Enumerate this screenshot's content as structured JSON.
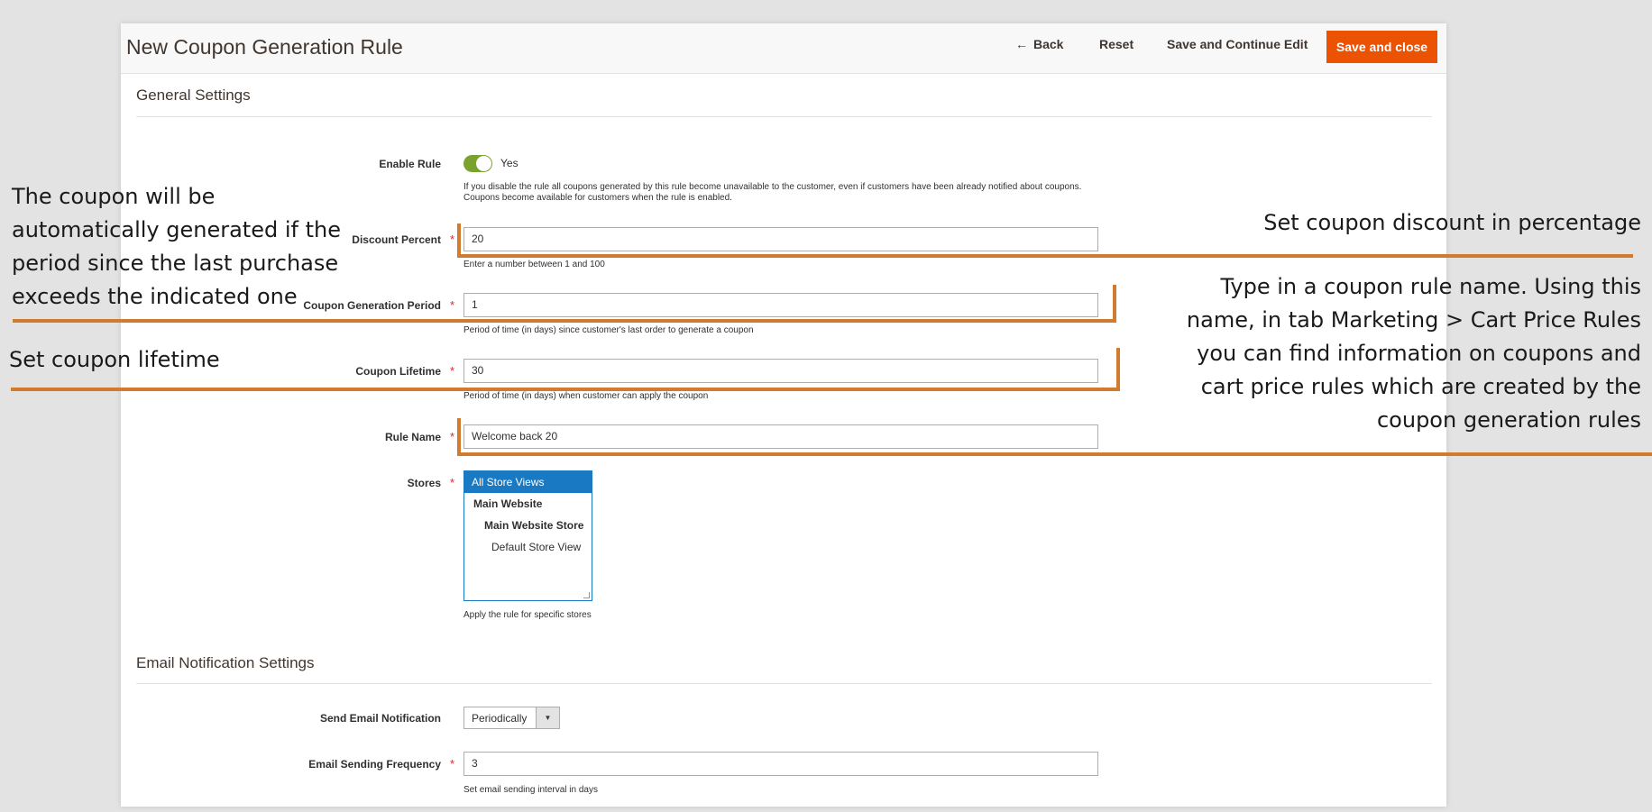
{
  "header": {
    "page_title": "New Coupon Generation Rule",
    "back_label": "Back",
    "reset_label": "Reset",
    "save_continue_label": "Save and Continue Edit",
    "save_close_label": "Save and close"
  },
  "sections": {
    "general": "General Settings",
    "email": "Email Notification Settings"
  },
  "fields": {
    "enable_rule": {
      "label": "Enable Rule",
      "value": "Yes",
      "note": "If you disable the rule all coupons generated by this rule become unavailable to the customer, even if customers have been already notified about coupons. Coupons become available for customers when the rule is enabled."
    },
    "discount_percent": {
      "label": "Discount Percent",
      "value": "20",
      "note": "Enter a number between 1 and 100"
    },
    "coupon_generation_period": {
      "label": "Coupon Generation Period",
      "value": "1",
      "note": "Period of time (in days) since customer's last order to generate a coupon"
    },
    "coupon_lifetime": {
      "label": "Coupon Lifetime",
      "value": "30",
      "note": "Period of time (in days) when customer can apply the coupon"
    },
    "rule_name": {
      "label": "Rule Name",
      "value": "Welcome back 20"
    },
    "stores": {
      "label": "Stores",
      "options": [
        "All Store Views",
        "Main Website",
        "Main Website Store",
        "Default Store View"
      ],
      "note": "Apply the rule for specific stores"
    },
    "send_email": {
      "label": "Send Email Notification",
      "value": "Periodically"
    },
    "email_frequency": {
      "label": "Email Sending Frequency",
      "value": "3",
      "note": "Set email sending interval in days"
    }
  },
  "annotations": {
    "discount": "Set coupon discount in percentage",
    "period": "The coupon will be automatically generated if the period since the last purchase exceeds the indicated one",
    "lifetime": "Set coupon lifetime",
    "rule_name": "Type in a coupon rule name. Using this name, in tab Marketing > Cart Price Rules you can find information on coupons and cart price rules which are created by the coupon generation rules"
  },
  "icons": {
    "back": "arrow-left-icon",
    "select": "caret-down-icon",
    "required": "asterisk-icon"
  },
  "colors": {
    "primary": "#eb5202",
    "toggle": "#79a22e",
    "annotation_line": "#d27a2d",
    "selected": "#1979c3"
  }
}
